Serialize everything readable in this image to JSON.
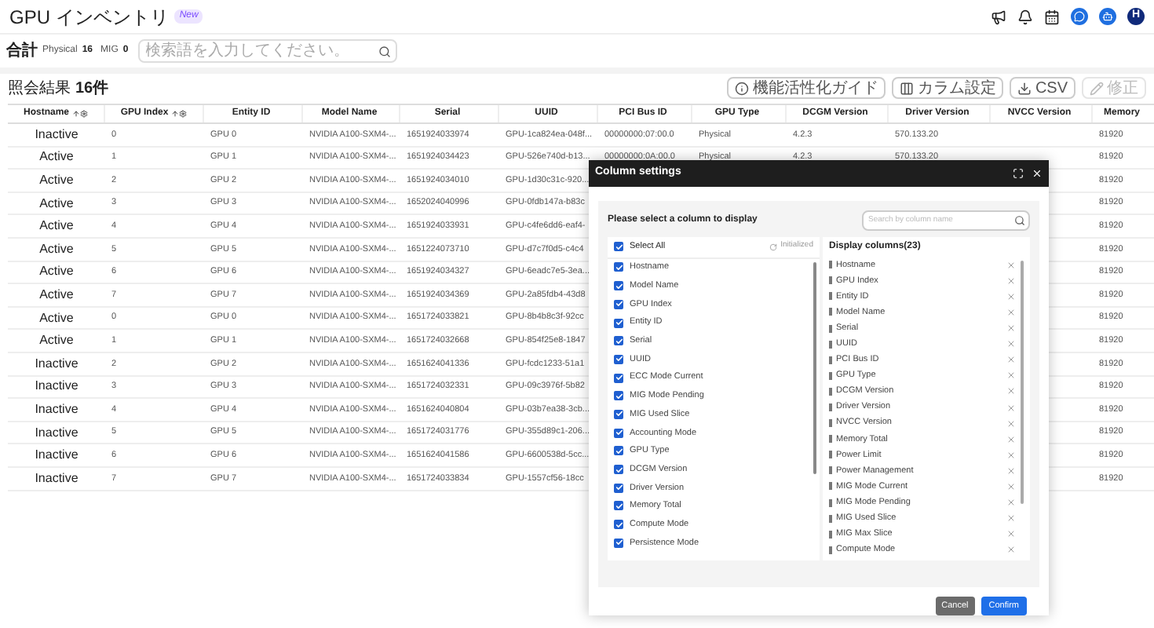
{
  "header": {
    "title": "GPU インベントリ",
    "badge": "New",
    "avatar": "H"
  },
  "filter": {
    "total_label": "合計",
    "physical_label": "Physical",
    "physical_count": "16",
    "mig_label": "MIG",
    "mig_count": "0",
    "search_placeholder": "検索語を入力してください。"
  },
  "results": {
    "label": "照会結果",
    "count": "16件"
  },
  "toolbar": [
    {
      "kind": "guide",
      "label": "機能活性化ガイド",
      "disabled": false
    },
    {
      "kind": "columns",
      "label": "カラム設定",
      "disabled": false
    },
    {
      "kind": "csv",
      "label": "CSV",
      "disabled": false
    },
    {
      "kind": "edit",
      "label": "修正",
      "disabled": true
    }
  ],
  "table": {
    "columns": [
      {
        "label": "Hostname",
        "sortable": true
      },
      {
        "label": "GPU Index",
        "sortable": true
      },
      {
        "label": "Entity ID",
        "sortable": false
      },
      {
        "label": "Model Name",
        "sortable": false
      },
      {
        "label": "Serial",
        "sortable": false
      },
      {
        "label": "UUID",
        "sortable": false
      },
      {
        "label": "PCI Bus ID",
        "sortable": false
      },
      {
        "label": "GPU Type",
        "sortable": false
      },
      {
        "label": "DCGM Version",
        "sortable": false
      },
      {
        "label": "Driver Version",
        "sortable": false
      },
      {
        "label": "NVCC Version",
        "sortable": false
      },
      {
        "label": "Memory",
        "sortable": false
      }
    ],
    "rows": [
      {
        "cells": [
          "Inactive",
          "0",
          "GPU 0",
          "NVIDIA A100-SXM4-...",
          "1651924033974",
          "GPU-1ca824ea-048f...",
          "00000000:07:00.0",
          "Physical",
          "4.2.3",
          "570.133.20",
          null,
          "81920"
        ]
      },
      {
        "cells": [
          "Active",
          "1",
          "GPU 1",
          "NVIDIA A100-SXM4-...",
          "1651924034423",
          "GPU-526e740d-b13...",
          "00000000:0A:00.0",
          "Physical",
          "4.2.3",
          "570.133.20",
          null,
          "81920"
        ]
      },
      {
        "cells": [
          "Active",
          "2",
          "GPU 2",
          "NVIDIA A100-SXM4-...",
          "1651924034010",
          "GPU-1d30c31c-920...",
          null,
          null,
          null,
          null,
          null,
          "81920"
        ]
      },
      {
        "cells": [
          "Active",
          "3",
          "GPU 3",
          "NVIDIA A100-SXM4-...",
          "1652024040996",
          "GPU-0fdb147a-b83c",
          null,
          null,
          null,
          null,
          null,
          "81920"
        ]
      },
      {
        "cells": [
          "Active",
          "4",
          "GPU 4",
          "NVIDIA A100-SXM4-...",
          "1651924033931",
          "GPU-c4fe6dd6-eaf4-",
          null,
          null,
          null,
          null,
          null,
          "81920"
        ]
      },
      {
        "cells": [
          "Active",
          "5",
          "GPU 5",
          "NVIDIA A100-SXM4-...",
          "1651224073710",
          "GPU-d7c7f0d5-c4c4",
          null,
          null,
          null,
          null,
          null,
          "81920"
        ]
      },
      {
        "cells": [
          "Active",
          "6",
          "GPU 6",
          "NVIDIA A100-SXM4-...",
          "1651924034327",
          "GPU-6eadc7e5-3ea...",
          null,
          null,
          null,
          null,
          null,
          "81920"
        ]
      },
      {
        "cells": [
          "Active",
          "7",
          "GPU 7",
          "NVIDIA A100-SXM4-...",
          "1651924034369",
          "GPU-2a85fdb4-43d8",
          null,
          null,
          null,
          null,
          null,
          "81920"
        ]
      },
      {
        "cells": [
          "Active",
          "0",
          "GPU 0",
          "NVIDIA A100-SXM4-...",
          "1651724033821",
          "GPU-8b4b8c3f-92cc",
          null,
          null,
          null,
          null,
          null,
          "81920"
        ]
      },
      {
        "cells": [
          "Active",
          "1",
          "GPU 1",
          "NVIDIA A100-SXM4-...",
          "1651724032668",
          "GPU-854f25e8-1847",
          null,
          null,
          null,
          null,
          null,
          "81920"
        ]
      },
      {
        "cells": [
          "Inactive",
          "2",
          "GPU 2",
          "NVIDIA A100-SXM4-...",
          "1651624041336",
          "GPU-fcdc1233-51a1",
          null,
          null,
          null,
          null,
          null,
          "81920"
        ]
      },
      {
        "cells": [
          "Inactive",
          "3",
          "GPU 3",
          "NVIDIA A100-SXM4-...",
          "1651724032331",
          "GPU-09c3976f-5b82",
          null,
          null,
          null,
          null,
          null,
          "81920"
        ]
      },
      {
        "cells": [
          "Inactive",
          "4",
          "GPU 4",
          "NVIDIA A100-SXM4-...",
          "1651624040804",
          "GPU-03b7ea38-3cb...",
          null,
          null,
          null,
          null,
          null,
          "81920"
        ]
      },
      {
        "cells": [
          "Inactive",
          "5",
          "GPU 5",
          "NVIDIA A100-SXM4-...",
          "1651724031776",
          "GPU-355d89c1-206...",
          null,
          null,
          null,
          null,
          null,
          "81920"
        ]
      },
      {
        "cells": [
          "Inactive",
          "6",
          "GPU 6",
          "NVIDIA A100-SXM4-...",
          "1651624041586",
          "GPU-6600538d-5cc...",
          null,
          null,
          null,
          null,
          null,
          "81920"
        ]
      },
      {
        "cells": [
          "Inactive",
          "7",
          "GPU 7",
          "NVIDIA A100-SXM4-...",
          "1651724033834",
          "GPU-1557cf56-18cc",
          null,
          null,
          null,
          null,
          null,
          "81920"
        ]
      }
    ]
  },
  "dialog": {
    "title": "Column settings",
    "prompt": "Please select a column to display",
    "search_placeholder": "Search by column name",
    "select_all": {
      "label": "Select All",
      "checked": true
    },
    "reset_label": "Initialized",
    "available": [
      {
        "label": "Hostname",
        "checked": true
      },
      {
        "label": "Model Name",
        "checked": true
      },
      {
        "label": "GPU Index",
        "checked": true
      },
      {
        "label": "Entity ID",
        "checked": true
      },
      {
        "label": "Serial",
        "checked": true
      },
      {
        "label": "UUID",
        "checked": true
      },
      {
        "label": "ECC Mode Current",
        "checked": true
      },
      {
        "label": "MIG Mode Pending",
        "checked": true
      },
      {
        "label": "MIG Used Slice",
        "checked": true
      },
      {
        "label": "Accounting Mode",
        "checked": true
      },
      {
        "label": "GPU Type",
        "checked": true
      },
      {
        "label": "DCGM Version",
        "checked": true
      },
      {
        "label": "Driver Version",
        "checked": true
      },
      {
        "label": "Memory Total",
        "checked": true
      },
      {
        "label": "Compute Mode",
        "checked": true
      },
      {
        "label": "Persistence Mode",
        "checked": true
      }
    ],
    "display_title": "Display columns(23)",
    "display": [
      "Hostname",
      "GPU Index",
      "Entity ID",
      "Model Name",
      "Serial",
      "UUID",
      "PCI Bus ID",
      "GPU Type",
      "DCGM Version",
      "Driver Version",
      "NVCC Version",
      "Memory Total",
      "Power Limit",
      "Power Management",
      "MIG Mode Current",
      "MIG Mode Pending",
      "MIG Used Slice",
      "MIG Max Slice",
      "Compute Mode"
    ],
    "cancel": "Cancel",
    "confirm": "Confirm"
  }
}
